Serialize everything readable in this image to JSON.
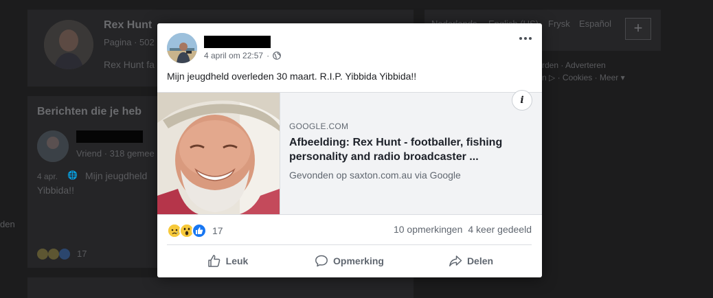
{
  "background": {
    "profile_name": "Rex Hunt",
    "profile_subtitle": "Pagina · 502",
    "profile_desc": "Rex Hunt fa",
    "section_title": "Berichten die je heb",
    "friend_meta": "Vriend · 318 gemee",
    "post_date": "4 apr.",
    "post_text_a": "Mijn jeugdheld",
    "post_text_b": "Yibbida!!",
    "side_text": "den",
    "reaction_count": "17",
    "languages": [
      "Nederlands",
      "English (US)",
      "Frysk",
      "Español"
    ],
    "footer_a": "rden · Adverteren",
    "footer_b": "n ▷ · Cookies · Meer ▾",
    "add_button": "+"
  },
  "post": {
    "timestamp": "4 april om 22:57",
    "separator": "·",
    "text": "Mijn jeugdheld overleden 30 maart. R.I.P. Yibbida Yibbida!!",
    "link": {
      "domain": "GOOGLE.COM",
      "title": "Afbeelding: Rex Hunt - footballer, fishing personality and radio broadcaster ...",
      "subtitle": "Gevonden op saxton.com.au via Google",
      "info_label": "i"
    },
    "reactions": {
      "types": [
        "sad",
        "wow",
        "like"
      ],
      "count": "17"
    },
    "comments": "10 opmerkingen",
    "shares": "4 keer gedeeld",
    "actions": {
      "like": "Leuk",
      "comment": "Opmerking",
      "share": "Delen"
    }
  },
  "colors": {
    "like_blue": "#1877f2",
    "emoji_yellow": "#f7c93b",
    "text_secondary": "#606770"
  },
  "icons": [
    "globe-icon",
    "more-icon",
    "info-icon",
    "thumbs-up-icon",
    "comment-icon",
    "share-icon"
  ]
}
